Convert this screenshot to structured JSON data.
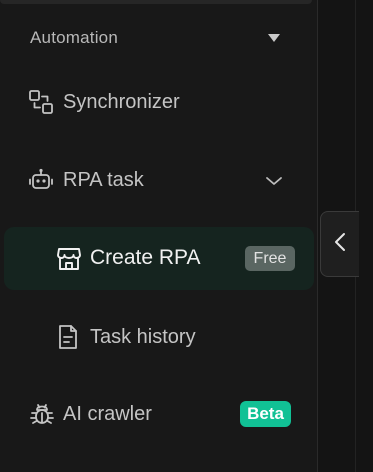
{
  "sidebar": {
    "section": {
      "title": "Automation",
      "icon": "caret-down-icon"
    },
    "items": [
      {
        "label": "Synchronizer",
        "icon": "sync-icon"
      },
      {
        "label": "RPA task",
        "icon": "robot-icon",
        "expand_icon": "chevron-down-icon"
      },
      {
        "label": "Create RPA",
        "icon": "store-icon",
        "badge": "Free",
        "active": true
      },
      {
        "label": "Task history",
        "icon": "document-icon"
      },
      {
        "label": "AI crawler",
        "icon": "bug-icon",
        "badge": "Beta"
      }
    ]
  },
  "collapse_toggle": {
    "icon": "chevron-left-icon"
  },
  "colors": {
    "background": "#181818",
    "active_item_bg": "#15241f",
    "beta_badge": "#11c195",
    "free_badge": "#5a6662",
    "text": "#c4c4c4"
  }
}
